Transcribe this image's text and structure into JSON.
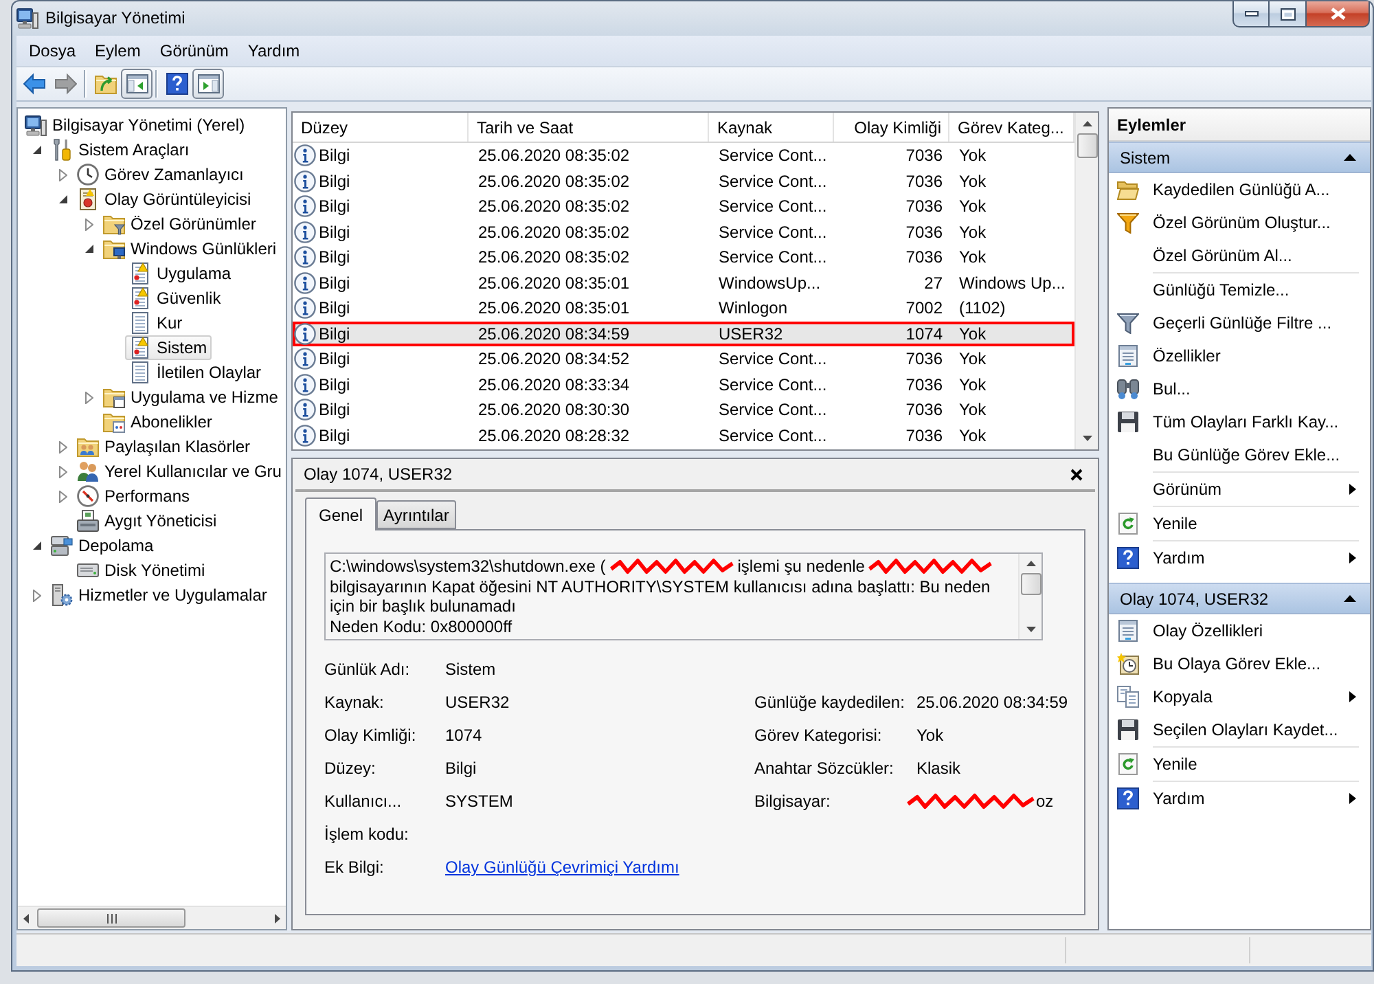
{
  "window": {
    "title": "Bilgisayar Yönetimi"
  },
  "menu": [
    "Dosya",
    "Eylem",
    "Görünüm",
    "Yardım"
  ],
  "toolbar": [
    [
      {
        "disabled": false
      },
      {
        "disabled": true
      }
    ],
    [
      {
        "disabled": false
      },
      {
        "disabled": false,
        "checked": true
      }
    ],
    [
      {
        "disabled": false
      },
      {
        "disabled": false,
        "checked": true
      }
    ]
  ],
  "tree": [
    {
      "label": "Bilgisayar Yönetimi (Yerel)",
      "selected": false,
      "children": [
        {
          "label": "Sistem Araçları",
          "expanded": true,
          "selected": false,
          "children": [
            {
              "label": "Görev Zamanlayıcı",
              "expanded": false,
              "selected": false
            },
            {
              "label": "Olay Görüntüleyicisi",
              "expanded": true,
              "selected": false,
              "children": [
                {
                  "label": "Özel Görünümler",
                  "expanded": false,
                  "selected": false
                },
                {
                  "label": "Windows Günlükleri",
                  "expanded": true,
                  "selected": false,
                  "children": [
                    {
                      "label": "Uygulama",
                      "selected": false
                    },
                    {
                      "label": "Güvenlik",
                      "selected": false
                    },
                    {
                      "label": "Kur",
                      "selected": false
                    },
                    {
                      "label": "Sistem",
                      "selected": true
                    },
                    {
                      "label": "İletilen Olaylar",
                      "selected": false
                    }
                  ]
                },
                {
                  "label": "Uygulama ve Hizme",
                  "expanded": false,
                  "selected": false
                },
                {
                  "label": "Abonelikler",
                  "selected": false
                }
              ]
            },
            {
              "label": "Paylaşılan Klasörler",
              "expanded": false,
              "selected": false
            },
            {
              "label": "Yerel Kullanıcılar ve Gru",
              "expanded": false,
              "selected": false
            },
            {
              "label": "Performans",
              "expanded": false,
              "selected": false
            },
            {
              "label": "Aygıt Yöneticisi",
              "selected": false
            }
          ]
        },
        {
          "label": "Depolama",
          "expanded": true,
          "selected": false,
          "children": [
            {
              "label": "Disk Yönetimi",
              "selected": false
            }
          ]
        },
        {
          "label": "Hizmetler ve Uygulamalar",
          "expanded": false,
          "selected": false
        }
      ]
    }
  ],
  "events": {
    "columns": [
      "Düzey",
      "Tarih ve Saat",
      "Kaynak",
      "Olay Kimliği",
      "Görev Kateg..."
    ],
    "rows": [
      {
        "severity": "Bilgi",
        "date": "25.06.2020 08:35:02",
        "source": "Service Cont...",
        "event_id": "7036",
        "category": "Yok",
        "selected": false,
        "marked": false
      },
      {
        "severity": "Bilgi",
        "date": "25.06.2020 08:35:02",
        "source": "Service Cont...",
        "event_id": "7036",
        "category": "Yok",
        "selected": false,
        "marked": false
      },
      {
        "severity": "Bilgi",
        "date": "25.06.2020 08:35:02",
        "source": "Service Cont...",
        "event_id": "7036",
        "category": "Yok",
        "selected": false,
        "marked": false
      },
      {
        "severity": "Bilgi",
        "date": "25.06.2020 08:35:02",
        "source": "Service Cont...",
        "event_id": "7036",
        "category": "Yok",
        "selected": false,
        "marked": false
      },
      {
        "severity": "Bilgi",
        "date": "25.06.2020 08:35:02",
        "source": "Service Cont...",
        "event_id": "7036",
        "category": "Yok",
        "selected": false,
        "marked": false
      },
      {
        "severity": "Bilgi",
        "date": "25.06.2020 08:35:01",
        "source": "WindowsUp...",
        "event_id": "27",
        "category": "Windows Up...",
        "selected": false,
        "marked": false
      },
      {
        "severity": "Bilgi",
        "date": "25.06.2020 08:35:01",
        "source": "Winlogon",
        "event_id": "7002",
        "category": "(1102)",
        "selected": false,
        "marked": false
      },
      {
        "severity": "Bilgi",
        "date": "25.06.2020 08:34:59",
        "source": "USER32",
        "event_id": "1074",
        "category": "Yok",
        "selected": true,
        "marked": true
      },
      {
        "severity": "Bilgi",
        "date": "25.06.2020 08:34:52",
        "source": "Service Cont...",
        "event_id": "7036",
        "category": "Yok",
        "selected": false,
        "marked": false
      },
      {
        "severity": "Bilgi",
        "date": "25.06.2020 08:33:34",
        "source": "Service Cont...",
        "event_id": "7036",
        "category": "Yok",
        "selected": false,
        "marked": false
      },
      {
        "severity": "Bilgi",
        "date": "25.06.2020 08:30:30",
        "source": "Service Cont...",
        "event_id": "7036",
        "category": "Yok",
        "selected": false,
        "marked": false
      },
      {
        "severity": "Bilgi",
        "date": "25.06.2020 08:28:32",
        "source": "Service Cont...",
        "event_id": "7036",
        "category": "Yok",
        "selected": false,
        "marked": false
      }
    ]
  },
  "details": {
    "title": "Olay 1074, USER32",
    "tabs": [
      {
        "label": "Genel",
        "selected": true
      },
      {
        "label": "Ayrıntılar",
        "selected": false
      }
    ],
    "description": {
      "segments": [
        {
          "kind": "text",
          "text": "C:\\windows\\system32\\shutdown.exe ("
        },
        {
          "kind": "redaction"
        },
        {
          "kind": "text",
          "text": "işlemi şu nedenle"
        },
        {
          "kind": "redaction"
        },
        {
          "kind": "text",
          "text": "bilgisayarının Kapat öğesini NT AUTHORITY\\SYSTEM kullanıcısı adına başlattı: Bu neden için bir başlık bulunamadı"
        }
      ],
      "reason": "Neden Kodu: 0x800000ff"
    },
    "left_fields": [
      {
        "label": "Günlük Adı:",
        "value": "Sistem",
        "kind": "text"
      },
      {
        "label": "Kaynak:",
        "value": "USER32",
        "kind": "text"
      },
      {
        "label": "Olay Kimliği:",
        "value": "1074",
        "kind": "text"
      },
      {
        "label": "Düzey:",
        "value": "Bilgi",
        "kind": "text"
      },
      {
        "label": "Kullanıcı...",
        "value": "SYSTEM",
        "kind": "text"
      },
      {
        "label": "İşlem kodu:",
        "kind": "text"
      },
      {
        "label": "Ek Bilgi:",
        "value": "Olay Günlüğü Çevrimiçi Yardımı",
        "kind": "link"
      }
    ],
    "right_fields": [
      {
        "label": "Günlüğe kaydedilen:",
        "value": "25.06.2020 08:34:59",
        "kind": "text"
      },
      {
        "label": "Görev Kategorisi:",
        "value": "Yok",
        "kind": "text"
      },
      {
        "label": "Anahtar Sözcükler:",
        "value": "Klasik",
        "kind": "text"
      },
      {
        "label": "Bilgisayar:",
        "value": "oz",
        "kind": "redacted"
      }
    ]
  },
  "actions": {
    "title": "Eylemler",
    "sections": [
      {
        "title": "Sistem",
        "expanded": true,
        "groups": [
          [
            {
              "label": "Kaydedilen Günlüğü A...",
              "submenu": false
            },
            {
              "label": "Özel Görünüm Oluştur...",
              "submenu": false
            },
            {
              "label": "Özel Görünüm Al...",
              "submenu": false
            }
          ],
          [
            {
              "label": "Günlüğü Temizle...",
              "submenu": false
            },
            {
              "label": "Geçerli Günlüğe Filtre ...",
              "submenu": false
            },
            {
              "label": "Özellikler",
              "submenu": false
            },
            {
              "label": "Bul...",
              "submenu": false
            },
            {
              "label": "Tüm Olayları Farklı Kay...",
              "submenu": false
            },
            {
              "label": "Bu Günlüğe Görev Ekle...",
              "submenu": false
            }
          ],
          [
            {
              "label": "Görünüm",
              "submenu": true
            }
          ],
          [
            {
              "label": "Yenile",
              "submenu": false
            }
          ],
          [
            {
              "label": "Yardım",
              "submenu": true
            }
          ]
        ]
      },
      {
        "title": "Olay 1074, USER32",
        "expanded": true,
        "groups": [
          [
            {
              "label": "Olay Özellikleri",
              "submenu": false
            },
            {
              "label": "Bu Olaya Görev Ekle...",
              "submenu": false
            },
            {
              "label": "Kopyala",
              "submenu": true
            },
            {
              "label": "Seçilen Olayları Kaydet...",
              "submenu": false
            }
          ],
          [
            {
              "label": "Yenile",
              "submenu": false
            }
          ],
          [
            {
              "label": "Yardım",
              "submenu": true
            }
          ]
        ]
      }
    ]
  }
}
